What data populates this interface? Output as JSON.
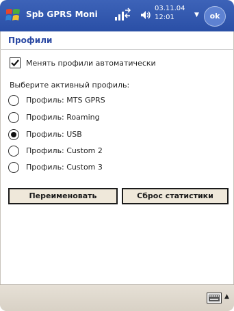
{
  "titlebar": {
    "app_title": "Spb GPRS Moni",
    "clock_line1": "03.11.04",
    "clock_line2": "12:01",
    "ok_label": "ok"
  },
  "page": {
    "heading": "Профили"
  },
  "options": {
    "auto_switch_label": "Менять профили автоматически",
    "auto_switch_checked": true,
    "choose_active_label": "Выберите активный профиль:"
  },
  "profiles": [
    {
      "label": "Профиль: MTS GPRS",
      "selected": false
    },
    {
      "label": "Профиль: Roaming",
      "selected": false
    },
    {
      "label": "Профиль: USB",
      "selected": true
    },
    {
      "label": "Профиль: Custom 2",
      "selected": false
    },
    {
      "label": "Профиль: Custom 3",
      "selected": false
    }
  ],
  "buttons": {
    "rename": "Переименовать",
    "reset_stats": "Сброс статистики"
  },
  "colors": {
    "titlebar": "#2f55ab",
    "heading": "#2b49a3",
    "button_face": "#efe8da",
    "menubar": "#ddd6ca"
  },
  "icons": {
    "start": "windows-flag-icon",
    "signal": "signal-icon",
    "volume": "volume-icon",
    "keyboard": "keyboard-icon"
  }
}
